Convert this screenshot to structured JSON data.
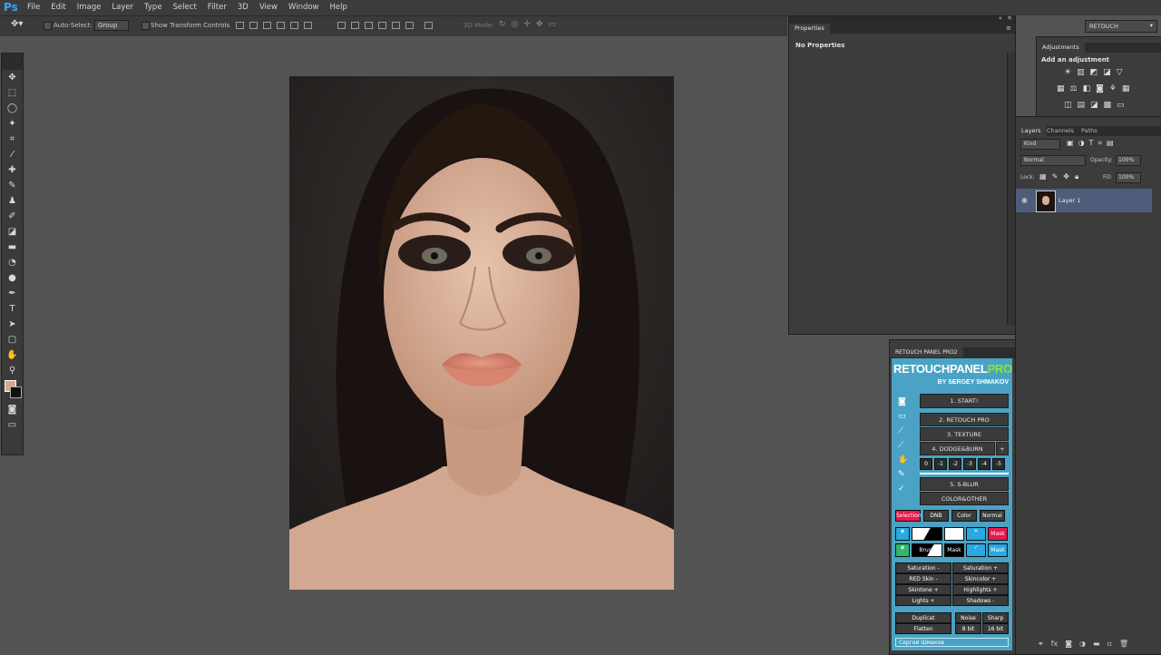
{
  "app": {
    "logo": "Ps"
  },
  "menu": [
    "File",
    "Edit",
    "Image",
    "Layer",
    "Type",
    "Select",
    "Filter",
    "3D",
    "View",
    "Window",
    "Help"
  ],
  "options_bar": {
    "auto_select_label": "Auto-Select:",
    "auto_select_value": "Group",
    "show_transform_label": "Show Transform Controls",
    "mode_3d_label": "3D Mode:"
  },
  "workspace": {
    "value": "RETOUCH"
  },
  "properties": {
    "tab": "Properties",
    "message": "No Properties"
  },
  "adjustments": {
    "tab": "Adjustments",
    "hint": "Add an adjustment"
  },
  "layers_panel": {
    "tabs": [
      "Layers",
      "Channels",
      "Paths"
    ],
    "filter_label": "Kind",
    "blend_mode": "Normal",
    "opacity_label": "Opacity:",
    "opacity_value": "100%",
    "lock_label": "Lock:",
    "fill_label": "Fill:",
    "fill_value": "100%",
    "layers": [
      {
        "name": "Layer 1"
      }
    ]
  },
  "retouch_panel": {
    "tab": "RETOUCH PANEL PRO2",
    "brand_retouch": "RETOUCH",
    "brand_panel": "PANEL",
    "brand_pro": "PRO",
    "byline_by": "BY ",
    "byline_author": "SERGEY SHMAKOV",
    "start": "1. START!",
    "retouch_pro": "2. RETOUCH PRO",
    "texture": "3. TEXTURE",
    "dodge_burn": "4. DODGE&BURN",
    "plus": "+",
    "levels": [
      "0",
      "-1",
      "-2",
      "-3",
      "-4",
      "-5"
    ],
    "sblur": "5. S-BLUR",
    "color_other": "COLOR&OTHER",
    "mode_buttons": [
      "Selection",
      "DNB",
      "Color",
      "Normal"
    ],
    "brush_label": "Brush",
    "mask_label": "Mask",
    "left_col": [
      "Saturation -",
      "RED Skin -",
      "Skintone +",
      "Lights +"
    ],
    "right_col": [
      "Saturation +",
      "Skincolor +",
      "Highlights +",
      "Shadows -"
    ],
    "duplicat": "Duplicat",
    "flatten": "Flatten",
    "noise": "Noise",
    "sharp": "Sharp",
    "bit8": "8 bit",
    "bit16": "16 bit",
    "footer": "Сергей Шмаков"
  },
  "colors": {
    "accent": "#31a8ff",
    "panel_teal": "#4aa3c4",
    "brand_green": "#8ee23a",
    "selection_red": "#e8184b",
    "mask_blue": "#27a9e1"
  }
}
